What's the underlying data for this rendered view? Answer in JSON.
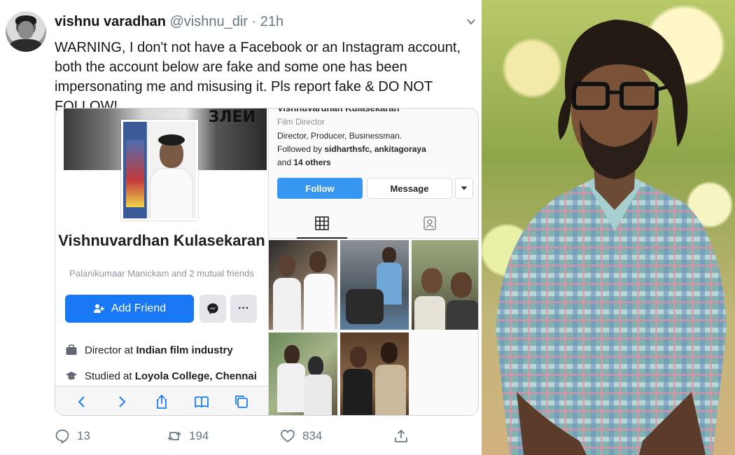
{
  "tweet": {
    "author_name": "vishnu varadhan",
    "handle": "@vishnu_dir",
    "separator": "·",
    "time": "21h",
    "text": "WARNING, I don't not have a Facebook or an Instagram account, both the account below are fake and some one has been impersonating me and misusing it. Pls report fake & DO NOT FOLLOW!",
    "replies": "13",
    "retweets": "194",
    "likes": "834"
  },
  "facebook_card": {
    "cover_text": "ЗЛЕИ",
    "profile_name": "Vishnuvardhan Kulasekaran",
    "mutual_friends": "Palanikumaar Manickam and 2 mutual friends",
    "add_friend_label": "Add Friend",
    "more_label": "···",
    "work_prefix": "Director at ",
    "work_place": "Indian film industry",
    "study_prefix": "Studied at ",
    "study_place": "Loyola College, Chennai"
  },
  "instagram_card": {
    "display_name": "Vishnuvardhan Kulasekaran",
    "category": "Film Director",
    "bio": "Director, Producer, Businessman.",
    "followed_by_prefix": "Followed by ",
    "followed_by_names": "sidharthsfc, ankitagoraya",
    "followed_by_and": "and ",
    "followed_by_others": "14 others",
    "follow_label": "Follow",
    "message_label": "Message"
  },
  "colors": {
    "facebook_blue": "#1877f2",
    "instagram_blue": "#3897f0",
    "twitter_gray": "#657786"
  }
}
